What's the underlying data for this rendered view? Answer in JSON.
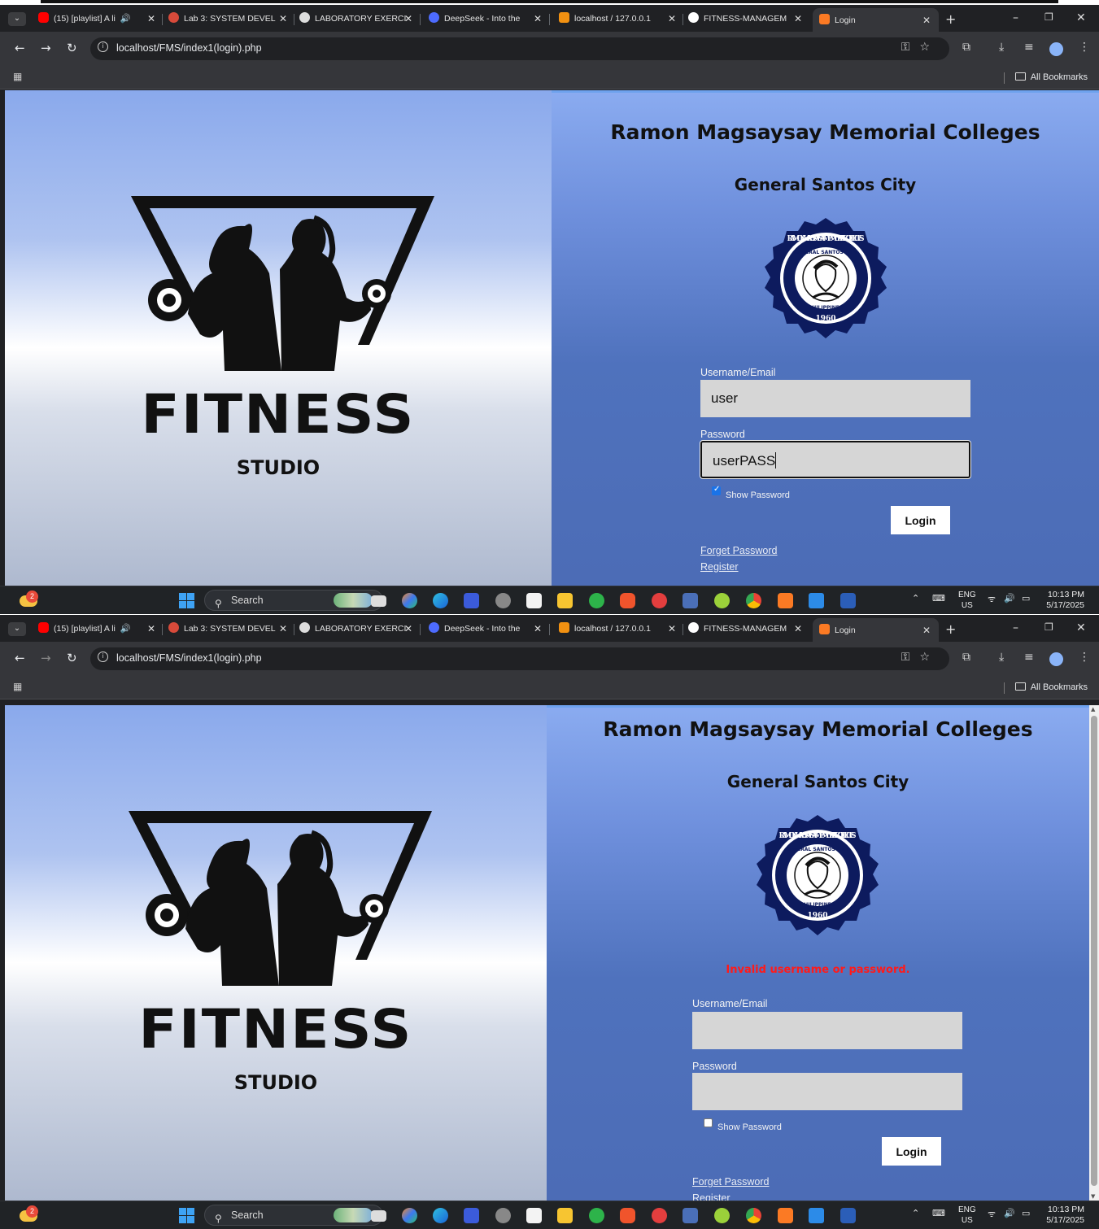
{
  "shots": [
    {
      "tabs": [
        {
          "label": "(15) [playlist] A li",
          "audio": true
        },
        {
          "label": "Lab 3: SYSTEM DEVEL"
        },
        {
          "label": "LABORATORY EXERCI"
        },
        {
          "label": "DeepSeek - Into the"
        },
        {
          "label": "localhost / 127.0.0.1"
        },
        {
          "label": "FITNESS-MANAGEM"
        },
        {
          "label": "Login",
          "active": true
        }
      ],
      "url": "localhost/FMS/index1(login).php",
      "all_bookmarks": "All Bookmarks",
      "logo_main": "FITNESS",
      "logo_sub": "STUDIO",
      "college_name": "Ramon Magsaysay Memorial Colleges",
      "college_city": "General Santos City",
      "error_message": "",
      "username_label": "Username/Email",
      "username_value": "user",
      "password_label": "Password",
      "password_value": "userPASS",
      "show_password_checked": true,
      "show_password_label": "Show Password",
      "login_label": "Login",
      "forget_password": "Forget Password",
      "register": "Register",
      "taskbar": {
        "search": "Search",
        "lang1": "ENG",
        "lang2": "US",
        "time": "10:13 PM",
        "date": "5/17/2025",
        "notif_count": "2"
      }
    },
    {
      "tabs": [
        {
          "label": "(15) [playlist] A li",
          "audio": true
        },
        {
          "label": "Lab 3: SYSTEM DEVEL"
        },
        {
          "label": "LABORATORY EXERCI"
        },
        {
          "label": "DeepSeek - Into the"
        },
        {
          "label": "localhost / 127.0.0.1"
        },
        {
          "label": "FITNESS-MANAGEM"
        },
        {
          "label": "Login",
          "active": true
        }
      ],
      "url": "localhost/FMS/index1(login).php",
      "all_bookmarks": "All Bookmarks",
      "logo_main": "FITNESS",
      "logo_sub": "STUDIO",
      "college_name": "Ramon Magsaysay Memorial Colleges",
      "college_city": "General Santos City",
      "error_message": "Invalid username or password.",
      "username_label": "Username/Email",
      "username_value": "",
      "password_label": "Password",
      "password_value": "",
      "show_password_checked": false,
      "show_password_label": "Show Password",
      "login_label": "Login",
      "forget_password": "Forget Password",
      "register": "Register",
      "taskbar": {
        "search": "Search",
        "lang1": "ENG",
        "lang2": "US",
        "time": "10:13 PM",
        "date": "5/17/2025",
        "notif_count": "2"
      }
    }
  ],
  "seal_text": {
    "outer_top": "RAMON MAGSAYSAY MEMORIAL COLLEGES",
    "inner_top": "GENERAL SANTOS CITY",
    "inner_bottom": "PHILIPPINES",
    "year": "1960"
  },
  "colors": {
    "browser_dark": "#202124",
    "toolbar": "#35363a",
    "error": "#ff1a1a",
    "right_panel": "#4f72bd",
    "seal_navy": "#0d1b5e"
  }
}
